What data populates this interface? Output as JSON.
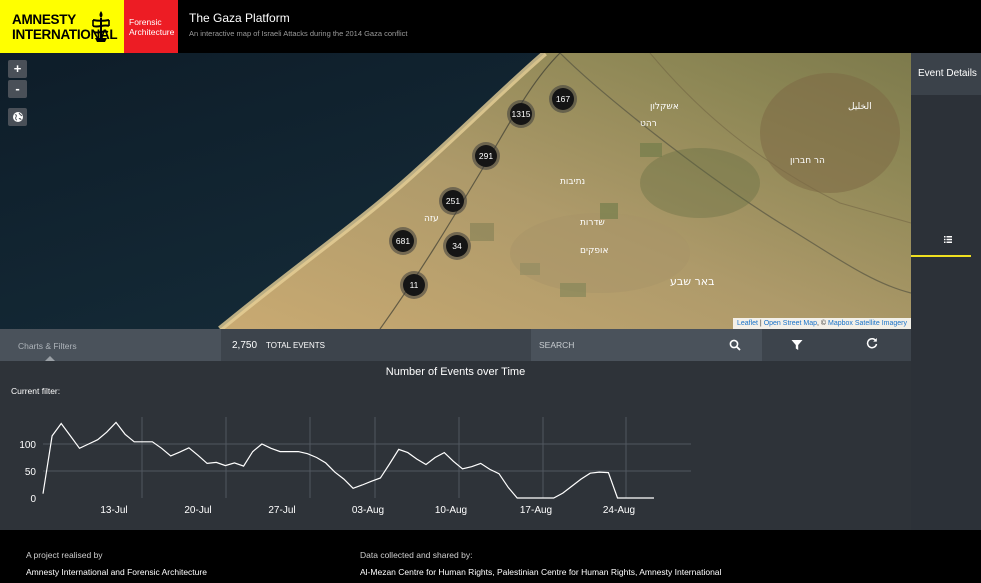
{
  "header": {
    "amnesty_logo_text": "AMNESTY INTERNATIONAL",
    "forensic_logo_text": "Forensic Architecture",
    "title": "The Gaza Platform",
    "subtitle": "An interactive map of Israeli Attacks during the 2014 Gaza conflict",
    "colors": {
      "amnesty_yellow": "#ffff00",
      "forensic_red": "#ed1c24"
    }
  },
  "map": {
    "zoom_in_label": "+",
    "zoom_out_label": "-",
    "globe_icon": "globe-icon",
    "clusters": [
      {
        "count": "167"
      },
      {
        "count": "1315"
      },
      {
        "count": "291"
      },
      {
        "count": "251"
      },
      {
        "count": "681"
      },
      {
        "count": "34"
      },
      {
        "count": "11"
      }
    ],
    "place_labels": [
      "עזה",
      "נתיבות",
      "באר שבע",
      "שדרות",
      "אשקלון",
      "אופקים",
      "רהט",
      "הר חברון",
      "الخليل"
    ],
    "attribution": {
      "leaflet": "Leaflet",
      "sep1": " | ",
      "osm": "Open Street Map",
      "sep2": ", © ",
      "mapbox": "Mapbox Satellite Imagery"
    }
  },
  "right_panel": {
    "header": "Event Details",
    "list_icon": "list-icon",
    "accent": "#f0e020"
  },
  "toolbar": {
    "charts_filters_label": "Charts & Filters",
    "total_count": "2,750",
    "total_label": "TOTAL EVENTS",
    "search_placeholder": "SEARCH",
    "search_icon": "search-icon",
    "filter_icon": "filter-icon",
    "refresh_icon": "refresh-icon"
  },
  "chart_panel": {
    "current_filter_label": "Current filter:"
  },
  "chart_data": {
    "type": "line",
    "title": "Number of Events over Time",
    "xlabel": "",
    "ylabel": "",
    "x_tick_labels": [
      "13-Jul",
      "20-Jul",
      "27-Jul",
      "03-Aug",
      "10-Aug",
      "17-Aug",
      "24-Aug"
    ],
    "y_tick_labels": [
      "100",
      "50",
      "0"
    ],
    "y_ticks": [
      100,
      50,
      0
    ],
    "ylim": [
      0,
      150
    ],
    "grid": true,
    "x": [
      "2014-07-08",
      "2014-07-09",
      "2014-07-10",
      "2014-07-11",
      "2014-07-12",
      "2014-07-13",
      "2014-07-14",
      "2014-07-15",
      "2014-07-16",
      "2014-07-17",
      "2014-07-18",
      "2014-07-19",
      "2014-07-20",
      "2014-07-21",
      "2014-07-22",
      "2014-07-23",
      "2014-07-24",
      "2014-07-25",
      "2014-07-26",
      "2014-07-27",
      "2014-07-28",
      "2014-07-29",
      "2014-07-30",
      "2014-07-31",
      "2014-08-01",
      "2014-08-02",
      "2014-08-03",
      "2014-08-04",
      "2014-08-05",
      "2014-08-06",
      "2014-08-07",
      "2014-08-08",
      "2014-08-09",
      "2014-08-10",
      "2014-08-11",
      "2014-08-12",
      "2014-08-13",
      "2014-08-14",
      "2014-08-15",
      "2014-08-16",
      "2014-08-17",
      "2014-08-18",
      "2014-08-19",
      "2014-08-20",
      "2014-08-21",
      "2014-08-22",
      "2014-08-23",
      "2014-08-24",
      "2014-08-25",
      "2014-08-26",
      "2014-08-27"
    ],
    "series": [
      {
        "values": [
          8,
          115,
          138,
          115,
          92,
          100,
          108,
          122,
          140,
          118,
          104,
          104,
          104,
          92,
          78,
          85,
          93,
          79,
          64,
          66,
          60,
          65,
          59,
          86,
          100,
          92,
          86,
          86,
          86,
          82,
          75,
          65,
          48,
          35,
          18,
          24,
          31,
          37,
          63,
          90,
          84,
          72,
          62,
          75,
          84,
          68,
          54,
          58,
          64,
          53,
          45,
          20,
          0,
          0,
          0,
          0,
          0,
          9,
          22,
          35,
          46,
          48,
          47,
          0,
          0,
          0,
          0,
          0
        ]
      }
    ]
  }
}
